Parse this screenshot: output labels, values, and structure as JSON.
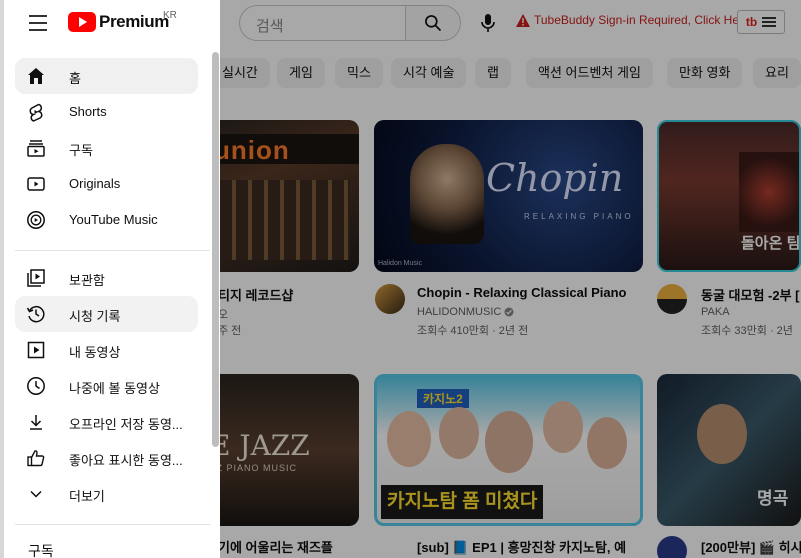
{
  "colors": {
    "brand_red": "#ff0000",
    "warning_red": "#cc1f1f"
  },
  "header": {
    "logo_text": "Premium",
    "region": "KR",
    "search_placeholder": "검색",
    "tubebuddy_warning": "TubeBuddy Sign-in Required, Click Here",
    "tubebuddy_logo": "tb"
  },
  "chips": [
    "실시간",
    "게임",
    "믹스",
    "시각 예술",
    "랩",
    "액션 어드벤처 게임",
    "만화 영화",
    "요리"
  ],
  "drawer": {
    "items": [
      {
        "label": "홈",
        "icon": "home-icon"
      },
      {
        "label": "Shorts",
        "icon": "shorts-icon"
      },
      {
        "label": "구독",
        "icon": "subscriptions-icon"
      },
      {
        "label": "Originals",
        "icon": "originals-icon"
      },
      {
        "label": "YouTube Music",
        "icon": "youtube-music-icon"
      },
      {
        "label": "보관함",
        "icon": "library-icon"
      },
      {
        "label": "시청 기록",
        "icon": "history-icon"
      },
      {
        "label": "내 동영상",
        "icon": "my-videos-icon"
      },
      {
        "label": "나중에 볼 동영상",
        "icon": "watch-later-icon"
      },
      {
        "label": "오프라인 저장 동영...",
        "icon": "download-icon"
      },
      {
        "label": "좋아요 표시한 동영...",
        "icon": "thumbs-up-icon"
      },
      {
        "label": "더보기",
        "icon": "chevron-down-icon"
      }
    ],
    "section_subscriptions": "구독"
  },
  "videos": [
    {
      "thumb_text": "union",
      "title": "티지 레코드샵",
      "channel": "오",
      "meta": "주 전"
    },
    {
      "thumb_text": "Chopin",
      "thumb_sub": "RELAXING PIANO",
      "thumb_corner": "Halidon Music",
      "title": "Chopin - Relaxing Classical Piano",
      "channel": "HALIDONMUSIC",
      "meta": "조회수 410만회 · 2년 전"
    },
    {
      "thumb_text": "돌아온 팀",
      "title": "동굴 대모험 -2부 [",
      "channel": "PAKA",
      "meta": "조회수 33만회 · 2년"
    },
    {
      "thumb_text": "E JAZZ",
      "thumb_sub": "ZZ PIANO MUSIC",
      "title": "기에 어울리는 재즈플",
      "channel": "",
      "meta": ""
    },
    {
      "thumb_text": "카지노탐 폼 미쳤다",
      "thumb_badge": "카지노2",
      "title": "[sub] 📘 EP1 | 흥망진창 카지노탐, 예",
      "channel": "",
      "meta": ""
    },
    {
      "thumb_text": "명곡",
      "title": "[200만뷰] 🎬 히시",
      "channel": "",
      "meta": ""
    }
  ]
}
